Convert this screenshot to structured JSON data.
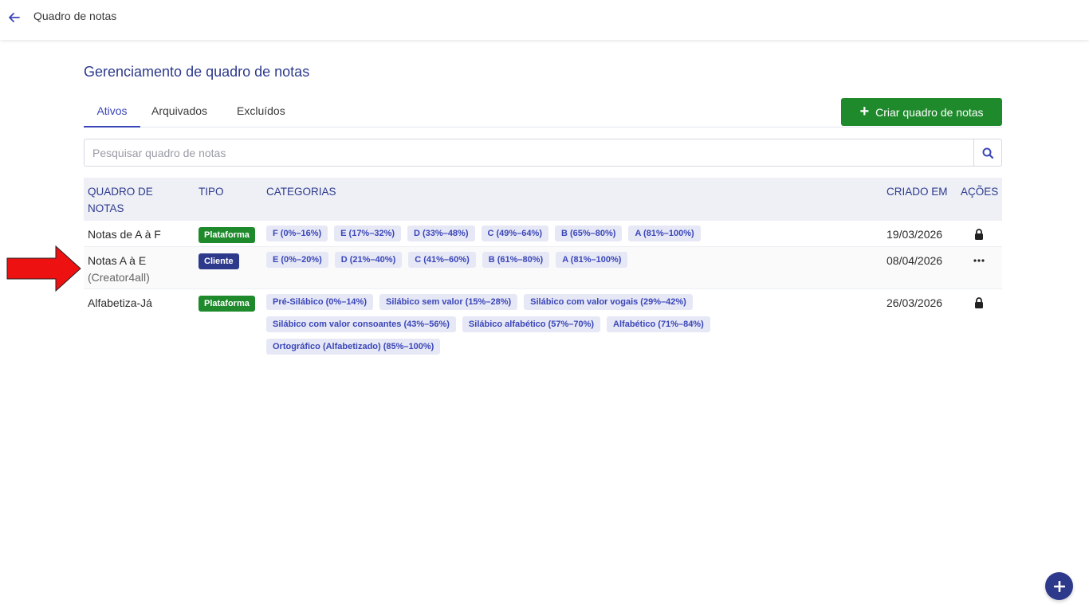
{
  "topbar": {
    "title": "Quadro de notas",
    "back_icon": "arrow-left-icon"
  },
  "page": {
    "title": "Gerenciamento de quadro de notas"
  },
  "tabs": [
    {
      "label": "Ativos",
      "active": true
    },
    {
      "label": "Arquivados",
      "active": false
    },
    {
      "label": "Excluídos",
      "active": false
    }
  ],
  "create_button": {
    "label": "Criar quadro de notas",
    "color": "#1e8a2c"
  },
  "search": {
    "placeholder": "Pesquisar quadro de notas",
    "value": ""
  },
  "table": {
    "headers": {
      "name": "QUADRO DE NOTAS",
      "tipo": "TIPO",
      "categorias": "CATEGORIAS",
      "criado": "CRIADO EM",
      "acoes": "AÇÕES"
    },
    "rows": [
      {
        "name": "Notas de A à F",
        "sub": "",
        "tipo": "Plataforma",
        "categorias": [
          "F (0%–16%)",
          "E (17%–32%)",
          "D (33%–48%)",
          "C (49%–64%)",
          "B (65%–80%)",
          "A (81%–100%)"
        ],
        "criado": "19/03/2026",
        "acao": "lock-icon"
      },
      {
        "name": "Notas A à E",
        "sub": "(Creator4all)",
        "tipo": "Cliente",
        "categorias": [
          "E (0%–20%)",
          "D (21%–40%)",
          "C (41%–60%)",
          "B (61%–80%)",
          "A (81%–100%)"
        ],
        "criado": "08/04/2026",
        "acao": "more-horizontal-icon"
      },
      {
        "name": "Alfabetiza-Já",
        "sub": "",
        "tipo": "Plataforma",
        "categorias": [
          "Pré-Silábico (0%–14%)",
          "Silábico sem valor (15%–28%)",
          "Silábico com valor vogais (29%–42%)",
          "Silábico com valor consoantes (43%–56%)",
          "Silábico alfabético (57%–70%)",
          "Alfabético (71%–84%)",
          "Ortográfico (Alfabetizado) (85%–100%)"
        ],
        "criado": "26/03/2026",
        "acao": "lock-icon"
      }
    ]
  },
  "colors": {
    "accent": "#2d3a8c",
    "link": "#3a46b8",
    "success": "#1e8a2c",
    "chip_bg": "#e6e8f6",
    "annotation_arrow": "#ee1111"
  }
}
